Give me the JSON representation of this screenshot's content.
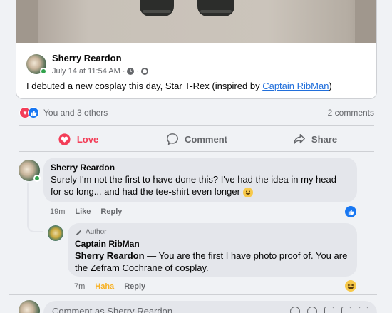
{
  "shared_post": {
    "author": "Sherry Reardon",
    "date": "July 14 at 11:54 AM",
    "separator": "·",
    "caption_prefix": "I debuted a new cosplay this day, Star T-Rex (inspired by ",
    "caption_link": "Captain RibMan",
    "caption_suffix": ")"
  },
  "reactions_summary": {
    "text": "You and 3 others",
    "comments_count": "2 comments"
  },
  "actions": {
    "love": "Love",
    "comment": "Comment",
    "share": "Share",
    "active_color": "#f33e58"
  },
  "comments": [
    {
      "author": "Sherry Reardon",
      "text": "Surely I'm not the first to have done this? I've had the idea in my head for so long... and had the tee-shirt even longer",
      "time": "19m",
      "like": "Like",
      "reply": "Reply",
      "reaction": "like"
    },
    {
      "badge": "Author",
      "author": "Captain RibMan",
      "mention": "Sherry Reardon",
      "text": " — You are the first I have photo proof of. You are the Zefram Cochrane of cosplay.",
      "time": "7m",
      "react_label": "Haha",
      "reply": "Reply",
      "reaction": "haha"
    }
  ],
  "composer": {
    "placeholder": "Comment as Sherry Reardon"
  },
  "colors": {
    "link": "#216fdb",
    "like_blue": "#1877f2",
    "love_red": "#f33e58",
    "haha_yellow": "#f7b125"
  }
}
